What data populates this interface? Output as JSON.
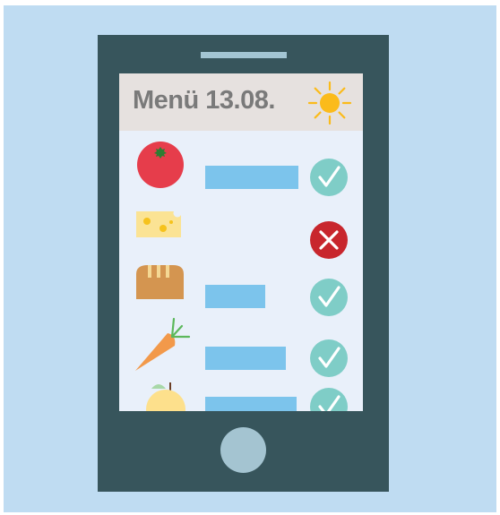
{
  "menu": {
    "title": "Menü 13.08.",
    "weather_icon": "sun-icon"
  },
  "items": [
    {
      "food_icon": "tomato-icon",
      "status": "approved",
      "status_icon": "check-icon"
    },
    {
      "food_icon": "cheese-icon",
      "status": "rejected",
      "status_icon": "close-icon"
    },
    {
      "food_icon": "bread-icon",
      "status": "approved",
      "status_icon": "check-icon"
    },
    {
      "food_icon": "carrot-icon",
      "status": "approved",
      "status_icon": "check-icon"
    },
    {
      "food_icon": "apple-icon",
      "status": "approved",
      "status_icon": "check-icon"
    }
  ],
  "colors": {
    "background": "#bfdcf2",
    "phone": "#37555c",
    "screen": "#e9f0fa",
    "header": "#e6e1df",
    "bar": "#7cc4ec",
    "check": "#7fcdc7",
    "reject": "#c8262d",
    "sun": "#fbbb1b"
  }
}
